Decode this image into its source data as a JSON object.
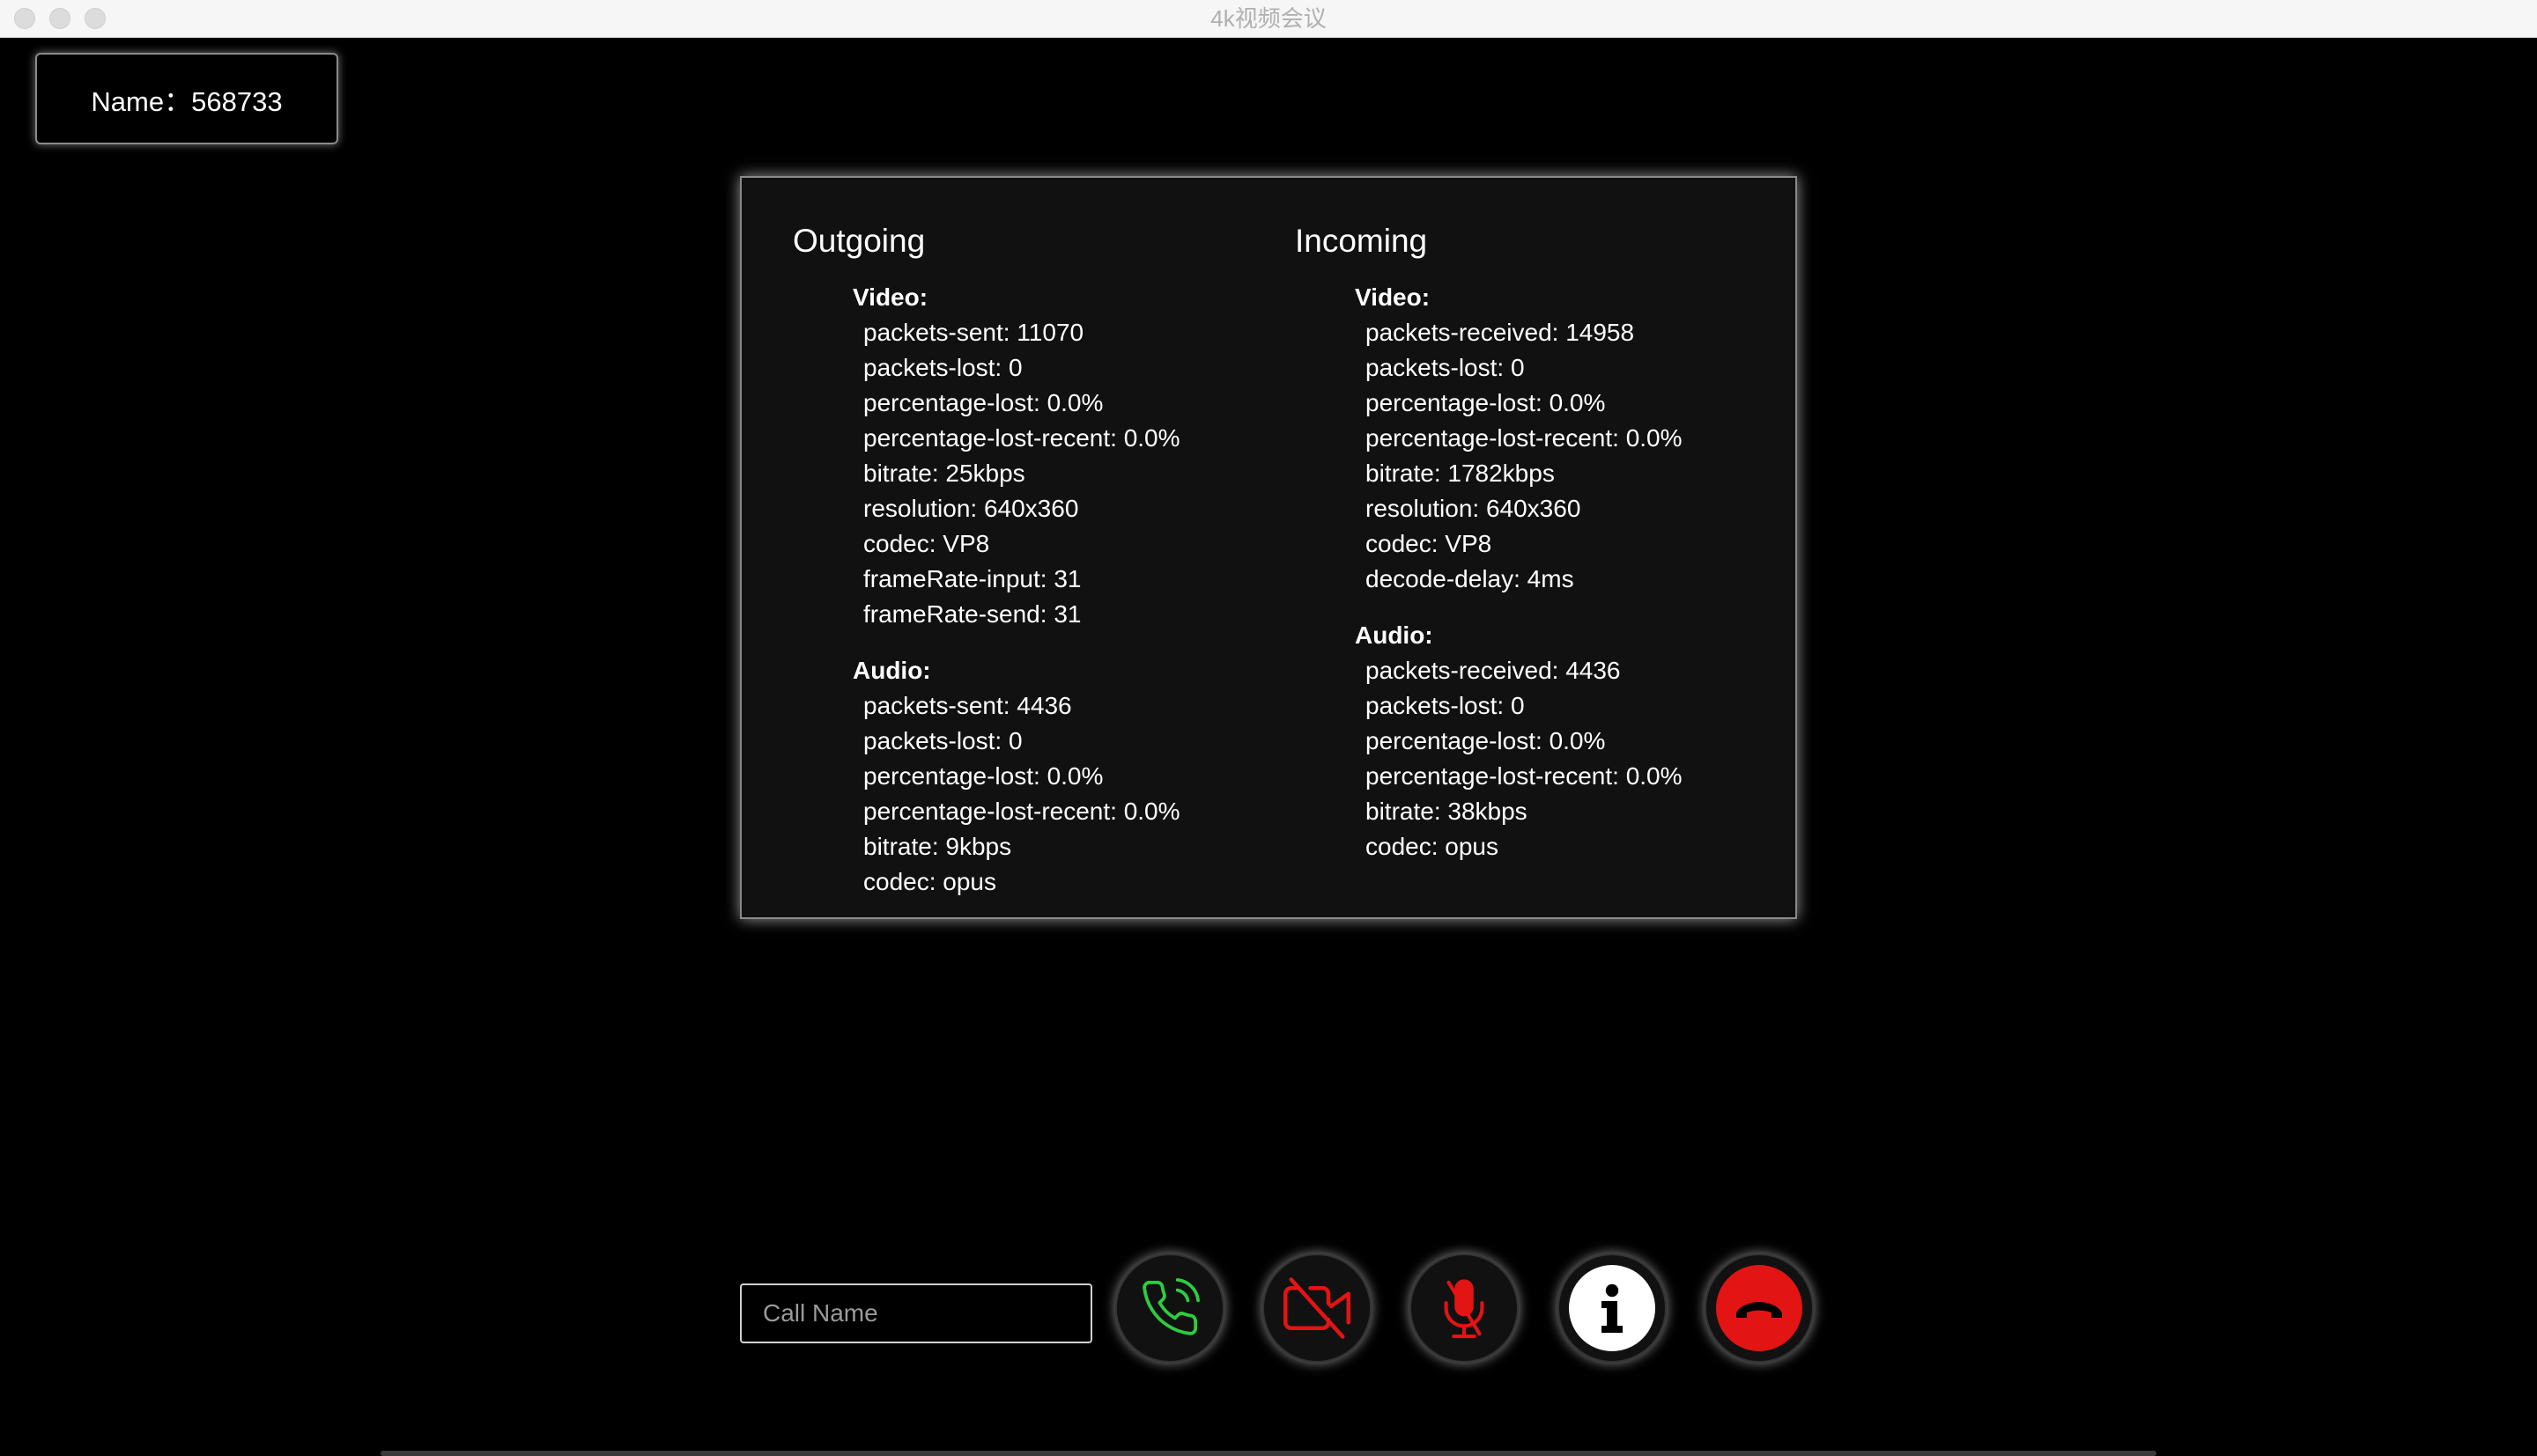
{
  "window": {
    "title": "4k视频会议"
  },
  "name_box": {
    "label": "Name：568733"
  },
  "stats": {
    "outgoing": {
      "title": "Outgoing",
      "video_label": "Video:",
      "video": [
        "packets-sent: 11070",
        "packets-lost: 0",
        "percentage-lost: 0.0%",
        "percentage-lost-recent: 0.0%",
        "bitrate: 25kbps",
        "resolution: 640x360",
        "codec: VP8",
        "frameRate-input: 31",
        "frameRate-send: 31"
      ],
      "audio_label": "Audio:",
      "audio": [
        "packets-sent: 4436",
        "packets-lost: 0",
        "percentage-lost: 0.0%",
        "percentage-lost-recent: 0.0%",
        "bitrate: 9kbps",
        "codec: opus"
      ]
    },
    "incoming": {
      "title": "Incoming",
      "video_label": "Video:",
      "video": [
        "packets-received: 14958",
        "packets-lost: 0",
        "percentage-lost: 0.0%",
        "percentage-lost-recent: 0.0%",
        "bitrate: 1782kbps",
        "resolution: 640x360",
        "codec: VP8",
        "decode-delay: 4ms"
      ],
      "audio_label": "Audio:",
      "audio": [
        "packets-received: 4436",
        "packets-lost: 0",
        "percentage-lost: 0.0%",
        "percentage-lost-recent: 0.0%",
        "bitrate: 38kbps",
        "codec: opus"
      ]
    }
  },
  "controls": {
    "call_input": {
      "value": "",
      "placeholder": "Call Name"
    },
    "buttons": [
      {
        "icon": "phone-call-icon",
        "color": "#2ecc40"
      },
      {
        "icon": "video-off-icon",
        "color": "#e21414"
      },
      {
        "icon": "mic-off-icon",
        "color": "#e21414"
      },
      {
        "icon": "info-icon",
        "color": "#ffffff"
      },
      {
        "icon": "hang-up-icon",
        "color": "#e21414"
      }
    ]
  },
  "colors": {
    "background": "#000000",
    "panel": "#111111",
    "accent_green": "#2ecc40",
    "accent_red": "#e21414"
  }
}
